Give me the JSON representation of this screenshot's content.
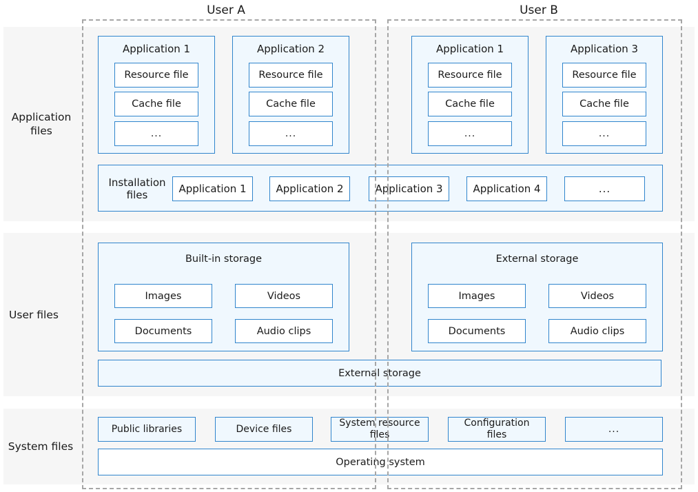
{
  "users": [
    {
      "title": "User A"
    },
    {
      "title": "User B"
    }
  ],
  "rows": {
    "application_files": "Application\nfiles",
    "user_files": "User files",
    "system_files": "System files"
  },
  "app_boxes": [
    {
      "title": "Application 1",
      "items": [
        "Resource file",
        "Cache file",
        "..."
      ]
    },
    {
      "title": "Application 2",
      "items": [
        "Resource file",
        "Cache file",
        "..."
      ]
    },
    {
      "title": "Application 1",
      "items": [
        "Resource file",
        "Cache file",
        "..."
      ]
    },
    {
      "title": "Application 3",
      "items": [
        "Resource file",
        "Cache file",
        "..."
      ]
    }
  ],
  "installation": {
    "label": "Installation\nfiles",
    "items": [
      "Application 1",
      "Application 2",
      "Application 3",
      "Application 4",
      "..."
    ]
  },
  "storage_boxes": [
    {
      "title": "Built-in storage",
      "items": [
        "Images",
        "Videos",
        "Documents",
        "Audio clips"
      ]
    },
    {
      "title": "External storage",
      "items": [
        "Images",
        "Videos",
        "Documents",
        "Audio clips"
      ]
    }
  ],
  "shared_external_storage": "External storage",
  "system": {
    "items": [
      "Public libraries",
      "Device files",
      "System resource\nfiles",
      "Configuration\nfiles",
      "..."
    ],
    "os": "Operating system"
  },
  "colors": {
    "border": "#2f84cc",
    "light_fill": "#f0f8fe",
    "band": "#f6f6f6",
    "dash": "#a6a6a6"
  }
}
